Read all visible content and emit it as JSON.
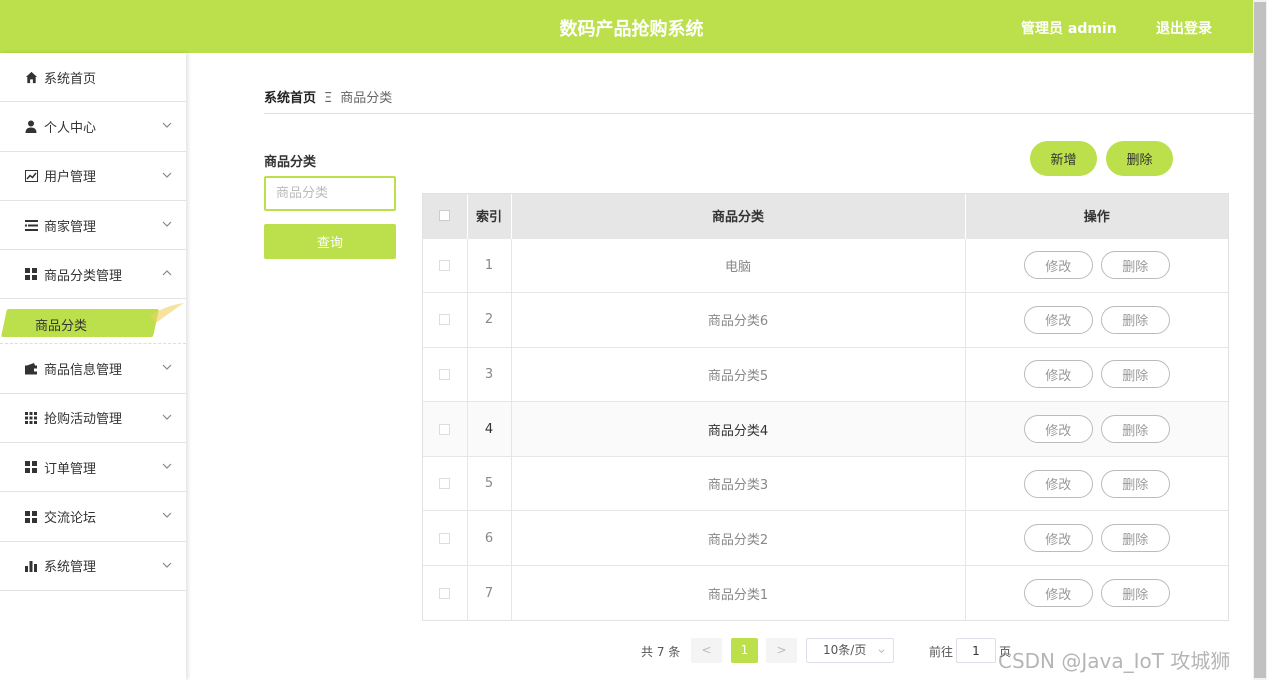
{
  "header": {
    "title": "数码产品抢购系统",
    "user": "管理员 admin",
    "logout": "退出登录"
  },
  "sidebar": {
    "items": [
      {
        "label": "系统首页",
        "icon": "home-icon"
      },
      {
        "label": "个人中心",
        "icon": "user-icon"
      },
      {
        "label": "用户管理",
        "icon": "chart-icon"
      },
      {
        "label": "商家管理",
        "icon": "list-icon"
      },
      {
        "label": "商品分类管理",
        "icon": "grid-icon"
      },
      {
        "label": "商品信息管理",
        "icon": "wallet-icon"
      },
      {
        "label": "抢购活动管理",
        "icon": "apps-icon"
      },
      {
        "label": "订单管理",
        "icon": "grid-icon"
      },
      {
        "label": "交流论坛",
        "icon": "grid-icon"
      },
      {
        "label": "系统管理",
        "icon": "bar-chart-icon"
      }
    ],
    "active_sub": "商品分类"
  },
  "breadcrumb": {
    "home": "系统首页",
    "separator": "Ξ",
    "current": "商品分类"
  },
  "search": {
    "label": "商品分类",
    "placeholder": "商品分类",
    "value": "",
    "button": "查询"
  },
  "actions": {
    "add": "新增",
    "delete": "删除"
  },
  "table": {
    "headers": [
      "索引",
      "商品分类",
      "操作"
    ],
    "rows": [
      {
        "index": "1",
        "category": "电脑"
      },
      {
        "index": "2",
        "category": "商品分类6"
      },
      {
        "index": "3",
        "category": "商品分类5"
      },
      {
        "index": "4",
        "category": "商品分类4"
      },
      {
        "index": "5",
        "category": "商品分类3"
      },
      {
        "index": "6",
        "category": "商品分类2"
      },
      {
        "index": "7",
        "category": "商品分类1"
      }
    ],
    "edit_label": "修改",
    "delete_label": "删除"
  },
  "pagination": {
    "total": "共 7 条",
    "prev": "<",
    "next": ">",
    "current_page": "1",
    "page_size": "10条/页",
    "goto_label": "前往",
    "goto_value": "1",
    "page_unit": "页"
  },
  "watermark": "CSDN @Java_IoT 攻城狮",
  "colors": {
    "accent": "#bbe04b"
  }
}
